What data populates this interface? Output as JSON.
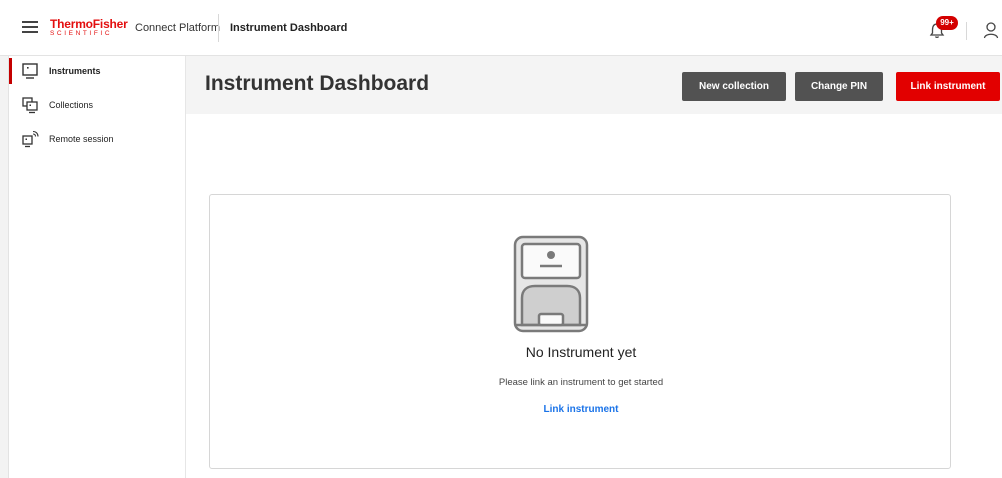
{
  "app": {
    "brand_line1": "ThermoFisher",
    "brand_line2": "SCIENTIFIC",
    "platform_name": "Connect Platform",
    "header_title": "Instrument Dashboard",
    "notification_badge": "99+"
  },
  "sidebar": {
    "items": [
      {
        "label": "Instruments",
        "icon": "monitor-icon",
        "active": true
      },
      {
        "label": "Collections",
        "icon": "collections-icon",
        "active": false
      },
      {
        "label": "Remote session",
        "icon": "remote-session-icon",
        "active": false
      }
    ]
  },
  "main": {
    "title": "Instrument Dashboard",
    "buttons": {
      "new_collection": "New collection",
      "change_pin": "Change PIN",
      "link_instrument": "Link instrument"
    },
    "empty_state": {
      "title": "No Instrument yet",
      "subtitle": "Please link an instrument to get started",
      "link": "Link instrument"
    }
  },
  "colors": {
    "brand_red": "#e30e0e",
    "primary_button": "#e20000",
    "secondary_button": "#525252",
    "link_blue": "#1a73e8"
  }
}
